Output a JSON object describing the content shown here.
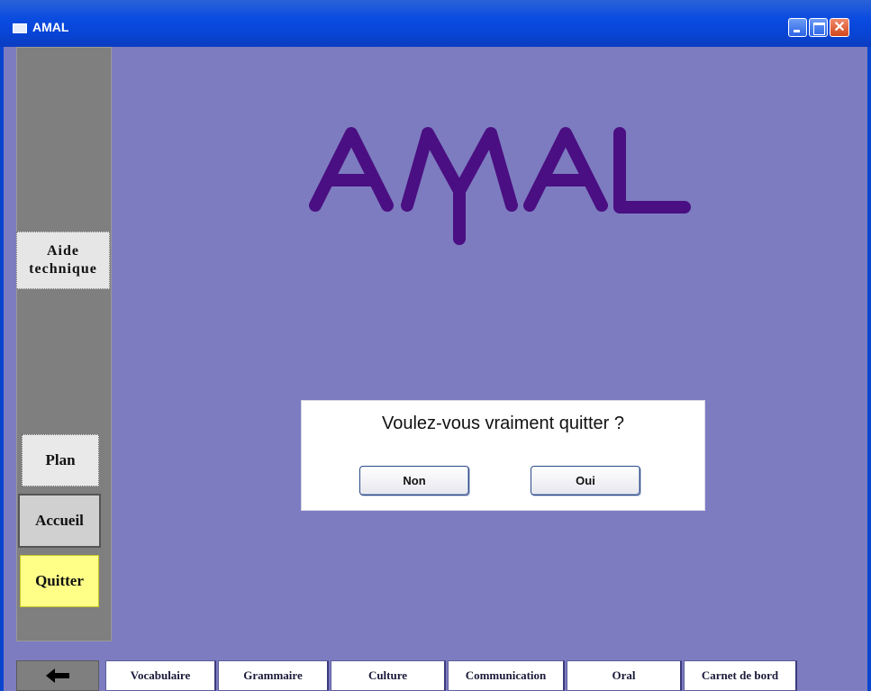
{
  "window": {
    "title": "AMAL",
    "controls": {
      "minimize_icon": "minimize-icon",
      "maximize_icon": "maximize-icon",
      "close_glyph": "✕"
    }
  },
  "logo": {
    "text": "AMAL",
    "color": "#4a0f82"
  },
  "sidebar": {
    "aide_line1": "Aide",
    "aide_line2": "technique",
    "plan": "Plan",
    "accueil": "Accueil",
    "quitter": "Quitter"
  },
  "dialog": {
    "question": "Voulez-vous vraiment quitter ?",
    "no_label": "Non",
    "yes_label": "Oui"
  },
  "bottom_nav": {
    "back_icon": "left-arrow-icon",
    "tabs": [
      "Vocabulaire",
      "Grammaire",
      "Culture",
      "Communication",
      "Oral",
      "Carnet de bord"
    ]
  },
  "colors": {
    "background": "#7d7cc0",
    "sidebar": "#7f7f7f",
    "quit_button": "#ffff88",
    "title_bar": "#0a45d0"
  }
}
